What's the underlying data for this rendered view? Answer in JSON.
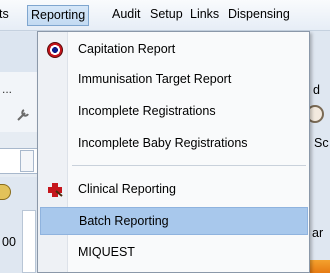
{
  "menubar": {
    "items": [
      {
        "label": "ts",
        "active": false
      },
      {
        "label": "Reporting",
        "active": true
      },
      {
        "label": "Audit",
        "active": false
      },
      {
        "label": "Setup",
        "active": false
      },
      {
        "label": "Links",
        "active": false
      },
      {
        "label": "Dispensing",
        "active": false
      }
    ]
  },
  "reporting_menu": {
    "items": [
      {
        "label": "Capitation Report",
        "icon": "target-icon"
      },
      {
        "label": "Immunisation Target Report",
        "icon": ""
      },
      {
        "label": "Incomplete Registrations",
        "icon": ""
      },
      {
        "label": "Incomplete Baby Registrations",
        "icon": ""
      },
      {
        "label": "Clinical Reporting",
        "icon": "clinical-reporting-icon"
      },
      {
        "label": "Batch Reporting",
        "icon": "",
        "selected": true
      },
      {
        "label": "MIQUEST",
        "icon": ""
      }
    ]
  },
  "background": {
    "left_ellipsis": "...",
    "left_value": "00",
    "right_d": "d",
    "right_sc": "Sc",
    "right_ar": "ar"
  },
  "colors": {
    "menu_highlight": "#a8c8ec",
    "active_menu_border": "#7fa6cf",
    "accent_orange": "#f4a12e"
  }
}
